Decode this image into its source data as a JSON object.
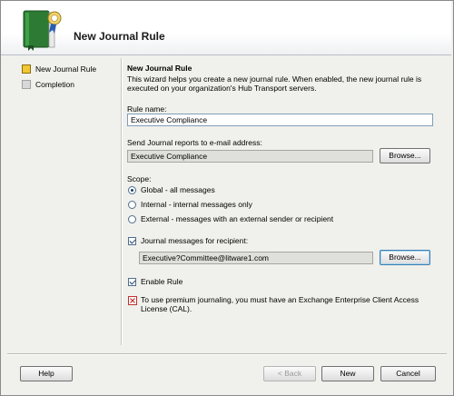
{
  "header": {
    "title": "New Journal Rule",
    "icon": "journal-rule-book-icon"
  },
  "nav": {
    "items": [
      {
        "label": "New Journal Rule",
        "state": "active"
      },
      {
        "label": "Completion",
        "state": "pending"
      }
    ]
  },
  "main": {
    "title": "New Journal Rule",
    "description": "This wizard helps you create a new journal rule. When enabled, the new journal rule is executed on your organization's Hub Transport servers.",
    "rule_name": {
      "label": "Rule name:",
      "value": "Executive Compliance"
    },
    "send_reports": {
      "label": "Send Journal reports to e-mail address:",
      "value": "Executive Compliance",
      "browse_label": "Browse..."
    },
    "scope": {
      "label": "Scope:",
      "options": [
        {
          "label": "Global - all messages",
          "checked": true
        },
        {
          "label": "Internal - internal messages only",
          "checked": false
        },
        {
          "label": "External - messages with an external sender or recipient",
          "checked": false
        }
      ]
    },
    "journal_recipient": {
      "label": "Journal messages for recipient:",
      "checked": true,
      "value": "Executive?Committee@litware1.com",
      "browse_label": "Browse..."
    },
    "enable_rule": {
      "label": "Enable Rule",
      "checked": true
    },
    "premium_note": {
      "text": "To use premium journaling, you must have an Exchange Enterprise Client Access License (CAL).",
      "icon": "premium-info-icon"
    }
  },
  "footer": {
    "help_label": "Help",
    "back_label": "< Back",
    "next_label": "New",
    "cancel_label": "Cancel"
  },
  "colors": {
    "accent": "#3c7fb1",
    "active_step": "#f1c732",
    "panel_bg": "#f0f0ec"
  }
}
